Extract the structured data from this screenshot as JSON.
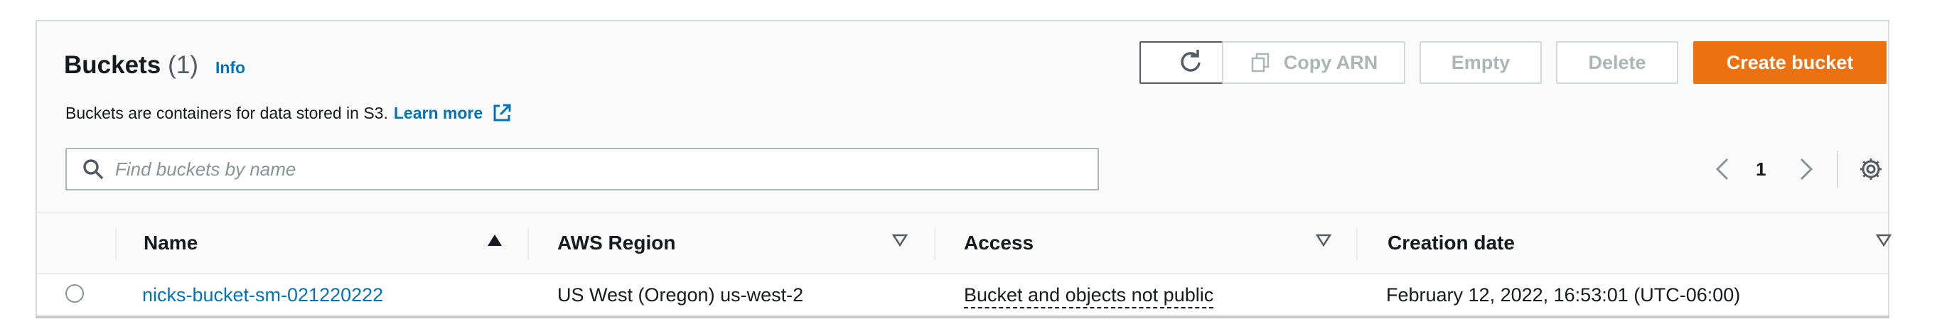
{
  "header": {
    "title": "Buckets",
    "count": "(1)",
    "info_link": "Info",
    "description": "Buckets are containers for data stored in S3.",
    "learn_more": "Learn more"
  },
  "toolbar": {
    "refresh_icon": "refresh-icon",
    "copy_arn_label": "Copy ARN",
    "copy_icon": "copy-icon",
    "empty_label": "Empty",
    "delete_label": "Delete",
    "create_label": "Create bucket"
  },
  "search": {
    "placeholder": "Find buckets by name",
    "value": ""
  },
  "pagination": {
    "current_page": "1",
    "prev_icon": "chevron-left-icon",
    "next_icon": "chevron-right-icon",
    "settings_icon": "gear-icon"
  },
  "table": {
    "columns": [
      "Name",
      "AWS Region",
      "Access",
      "Creation date"
    ],
    "rows": [
      {
        "name": "nicks-bucket-sm-021220222",
        "region": "US West (Oregon) us-west-2",
        "access": "Bucket and objects not public",
        "created": "February 12, 2022, 16:53:01 (UTC-06:00)"
      }
    ]
  },
  "colors": {
    "accent_link": "#0073bb",
    "primary_button": "#ec7211",
    "disabled_text": "#aab7b8",
    "border": "#d5dbdb"
  }
}
